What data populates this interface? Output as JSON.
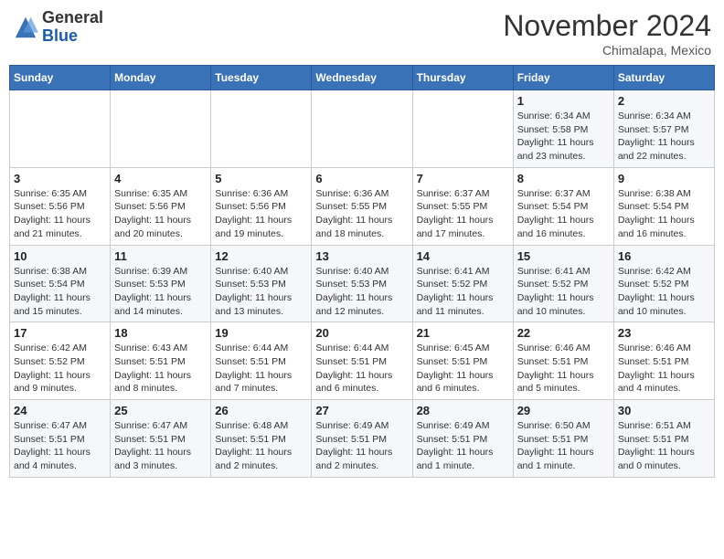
{
  "header": {
    "logo_general": "General",
    "logo_blue": "Blue",
    "month": "November 2024",
    "location": "Chimalapa, Mexico"
  },
  "weekdays": [
    "Sunday",
    "Monday",
    "Tuesday",
    "Wednesday",
    "Thursday",
    "Friday",
    "Saturday"
  ],
  "weeks": [
    [
      {
        "day": "",
        "info": ""
      },
      {
        "day": "",
        "info": ""
      },
      {
        "day": "",
        "info": ""
      },
      {
        "day": "",
        "info": ""
      },
      {
        "day": "",
        "info": ""
      },
      {
        "day": "1",
        "info": "Sunrise: 6:34 AM\nSunset: 5:58 PM\nDaylight: 11 hours and 23 minutes."
      },
      {
        "day": "2",
        "info": "Sunrise: 6:34 AM\nSunset: 5:57 PM\nDaylight: 11 hours and 22 minutes."
      }
    ],
    [
      {
        "day": "3",
        "info": "Sunrise: 6:35 AM\nSunset: 5:56 PM\nDaylight: 11 hours and 21 minutes."
      },
      {
        "day": "4",
        "info": "Sunrise: 6:35 AM\nSunset: 5:56 PM\nDaylight: 11 hours and 20 minutes."
      },
      {
        "day": "5",
        "info": "Sunrise: 6:36 AM\nSunset: 5:56 PM\nDaylight: 11 hours and 19 minutes."
      },
      {
        "day": "6",
        "info": "Sunrise: 6:36 AM\nSunset: 5:55 PM\nDaylight: 11 hours and 18 minutes."
      },
      {
        "day": "7",
        "info": "Sunrise: 6:37 AM\nSunset: 5:55 PM\nDaylight: 11 hours and 17 minutes."
      },
      {
        "day": "8",
        "info": "Sunrise: 6:37 AM\nSunset: 5:54 PM\nDaylight: 11 hours and 16 minutes."
      },
      {
        "day": "9",
        "info": "Sunrise: 6:38 AM\nSunset: 5:54 PM\nDaylight: 11 hours and 16 minutes."
      }
    ],
    [
      {
        "day": "10",
        "info": "Sunrise: 6:38 AM\nSunset: 5:54 PM\nDaylight: 11 hours and 15 minutes."
      },
      {
        "day": "11",
        "info": "Sunrise: 6:39 AM\nSunset: 5:53 PM\nDaylight: 11 hours and 14 minutes."
      },
      {
        "day": "12",
        "info": "Sunrise: 6:40 AM\nSunset: 5:53 PM\nDaylight: 11 hours and 13 minutes."
      },
      {
        "day": "13",
        "info": "Sunrise: 6:40 AM\nSunset: 5:53 PM\nDaylight: 11 hours and 12 minutes."
      },
      {
        "day": "14",
        "info": "Sunrise: 6:41 AM\nSunset: 5:52 PM\nDaylight: 11 hours and 11 minutes."
      },
      {
        "day": "15",
        "info": "Sunrise: 6:41 AM\nSunset: 5:52 PM\nDaylight: 11 hours and 10 minutes."
      },
      {
        "day": "16",
        "info": "Sunrise: 6:42 AM\nSunset: 5:52 PM\nDaylight: 11 hours and 10 minutes."
      }
    ],
    [
      {
        "day": "17",
        "info": "Sunrise: 6:42 AM\nSunset: 5:52 PM\nDaylight: 11 hours and 9 minutes."
      },
      {
        "day": "18",
        "info": "Sunrise: 6:43 AM\nSunset: 5:51 PM\nDaylight: 11 hours and 8 minutes."
      },
      {
        "day": "19",
        "info": "Sunrise: 6:44 AM\nSunset: 5:51 PM\nDaylight: 11 hours and 7 minutes."
      },
      {
        "day": "20",
        "info": "Sunrise: 6:44 AM\nSunset: 5:51 PM\nDaylight: 11 hours and 6 minutes."
      },
      {
        "day": "21",
        "info": "Sunrise: 6:45 AM\nSunset: 5:51 PM\nDaylight: 11 hours and 6 minutes."
      },
      {
        "day": "22",
        "info": "Sunrise: 6:46 AM\nSunset: 5:51 PM\nDaylight: 11 hours and 5 minutes."
      },
      {
        "day": "23",
        "info": "Sunrise: 6:46 AM\nSunset: 5:51 PM\nDaylight: 11 hours and 4 minutes."
      }
    ],
    [
      {
        "day": "24",
        "info": "Sunrise: 6:47 AM\nSunset: 5:51 PM\nDaylight: 11 hours and 4 minutes."
      },
      {
        "day": "25",
        "info": "Sunrise: 6:47 AM\nSunset: 5:51 PM\nDaylight: 11 hours and 3 minutes."
      },
      {
        "day": "26",
        "info": "Sunrise: 6:48 AM\nSunset: 5:51 PM\nDaylight: 11 hours and 2 minutes."
      },
      {
        "day": "27",
        "info": "Sunrise: 6:49 AM\nSunset: 5:51 PM\nDaylight: 11 hours and 2 minutes."
      },
      {
        "day": "28",
        "info": "Sunrise: 6:49 AM\nSunset: 5:51 PM\nDaylight: 11 hours and 1 minute."
      },
      {
        "day": "29",
        "info": "Sunrise: 6:50 AM\nSunset: 5:51 PM\nDaylight: 11 hours and 1 minute."
      },
      {
        "day": "30",
        "info": "Sunrise: 6:51 AM\nSunset: 5:51 PM\nDaylight: 11 hours and 0 minutes."
      }
    ]
  ]
}
